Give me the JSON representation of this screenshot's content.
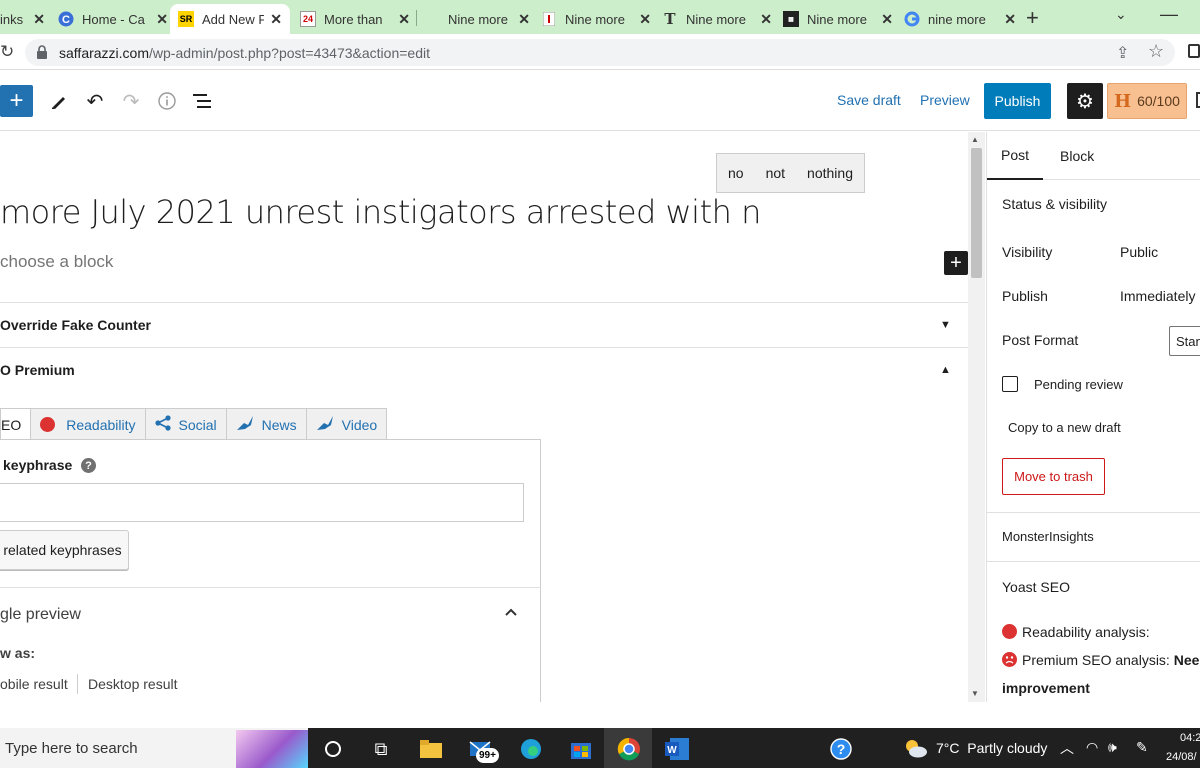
{
  "browser": {
    "tabs": [
      {
        "title": "inks",
        "icon": "link-icon",
        "active": false
      },
      {
        "title": "Home - Ca",
        "icon": "c-logo-icon",
        "active": false
      },
      {
        "title": "Add New P",
        "icon": "sr-logo-icon",
        "active": true
      },
      {
        "title": "More than",
        "icon": "calendar-24-icon",
        "active": false
      },
      {
        "title": "Nine more",
        "icon": "blank-icon",
        "active": false
      },
      {
        "title": "Nine more",
        "icon": "flag-icon",
        "active": false
      },
      {
        "title": "Nine more",
        "icon": "t-logo-icon",
        "active": false
      },
      {
        "title": "Nine more",
        "icon": "news-logo-icon",
        "active": false
      },
      {
        "title": "nine more",
        "icon": "google-icon",
        "active": false
      }
    ],
    "new_tab": "+",
    "url_host": "saffarazzi.com",
    "url_rest": "/wp-admin/post.php?post=43473&action=edit"
  },
  "toolbar": {
    "save_draft": "Save draft",
    "preview": "Preview",
    "publish": "Publish",
    "score": "60/100",
    "score_letter": "H"
  },
  "editor": {
    "suggestions": [
      "no",
      "not",
      "nothing"
    ],
    "title": "more July 2021 unrest instigators arrested with n",
    "choose_block": "choose a block",
    "panels": [
      {
        "label": "Override Fake Counter",
        "open": false
      },
      {
        "label": "O Premium",
        "open": true
      }
    ],
    "yoast_tabs": [
      {
        "label": "EO",
        "icon": ""
      },
      {
        "label": "Readability",
        "icon": "red-dot-icon"
      },
      {
        "label": "Social",
        "icon": "share-icon"
      },
      {
        "label": "News",
        "icon": "yoast-news-icon"
      },
      {
        "label": "Video",
        "icon": "yoast-video-icon"
      }
    ],
    "keyphrase_label": "keyphrase",
    "keyphrase_value": "",
    "related_btn": "related keyphrases",
    "google_preview": "gle preview",
    "preview_as": "w as:",
    "mobile_result": "obile result",
    "desktop_result": "Desktop result"
  },
  "sidebar": {
    "tab_post": "Post",
    "tab_block": "Block",
    "status_visibility": "Status & visibility",
    "visibility_label": "Visibility",
    "visibility_value": "Public",
    "publish_label": "Publish",
    "publish_value": "Immediately",
    "post_format_label": "Post Format",
    "post_format_value": "Stan",
    "pending_review": "Pending review",
    "copy_draft": "Copy to a new draft",
    "move_trash": "Move to trash",
    "monsterinsights": "MonsterInsights",
    "yoast_seo": "Yoast SEO",
    "readability_analysis": "Readability analysis:",
    "premium_seo_analysis": "Premium SEO analysis:",
    "premium_seo_status": "Nee",
    "improvement": "improvement"
  },
  "taskbar": {
    "search_placeholder": "Type here to search",
    "mail_badge": "99+",
    "weather": "7°C  Partly cloudy",
    "time": "04:2",
    "date": "24/08/"
  },
  "colors": {
    "accent": "#2271b1",
    "publish": "#007cba",
    "danger": "#cc1818",
    "yoast_red": "#dc3232",
    "tabbar": "#cdeecb"
  }
}
